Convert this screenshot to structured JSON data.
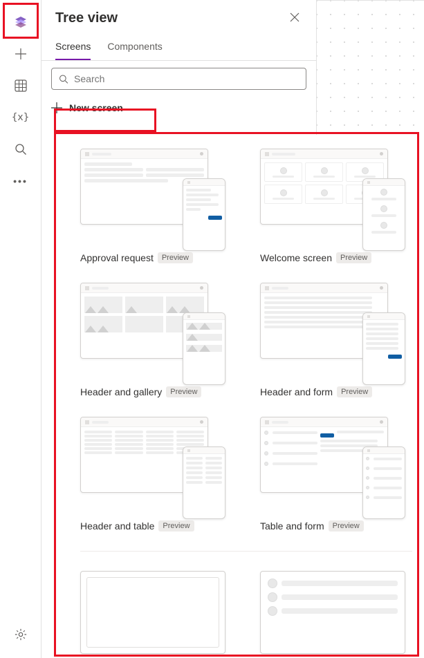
{
  "panel": {
    "title": "Tree view",
    "tabs": {
      "screens": "Screens",
      "components": "Components"
    },
    "search_placeholder": "Search",
    "new_screen": "New screen"
  },
  "badge": "Preview",
  "templates": {
    "approval": "Approval request",
    "welcome": "Welcome screen",
    "gallery": "Header and gallery",
    "form": "Header and form",
    "table": "Header and table",
    "tform": "Table and form"
  },
  "rail": {
    "tree": "tree-view-icon",
    "insert": "insert-icon",
    "data": "data-icon",
    "vars": "variables-icon",
    "search": "search-icon",
    "more": "more-icon",
    "settings": "settings-icon"
  }
}
